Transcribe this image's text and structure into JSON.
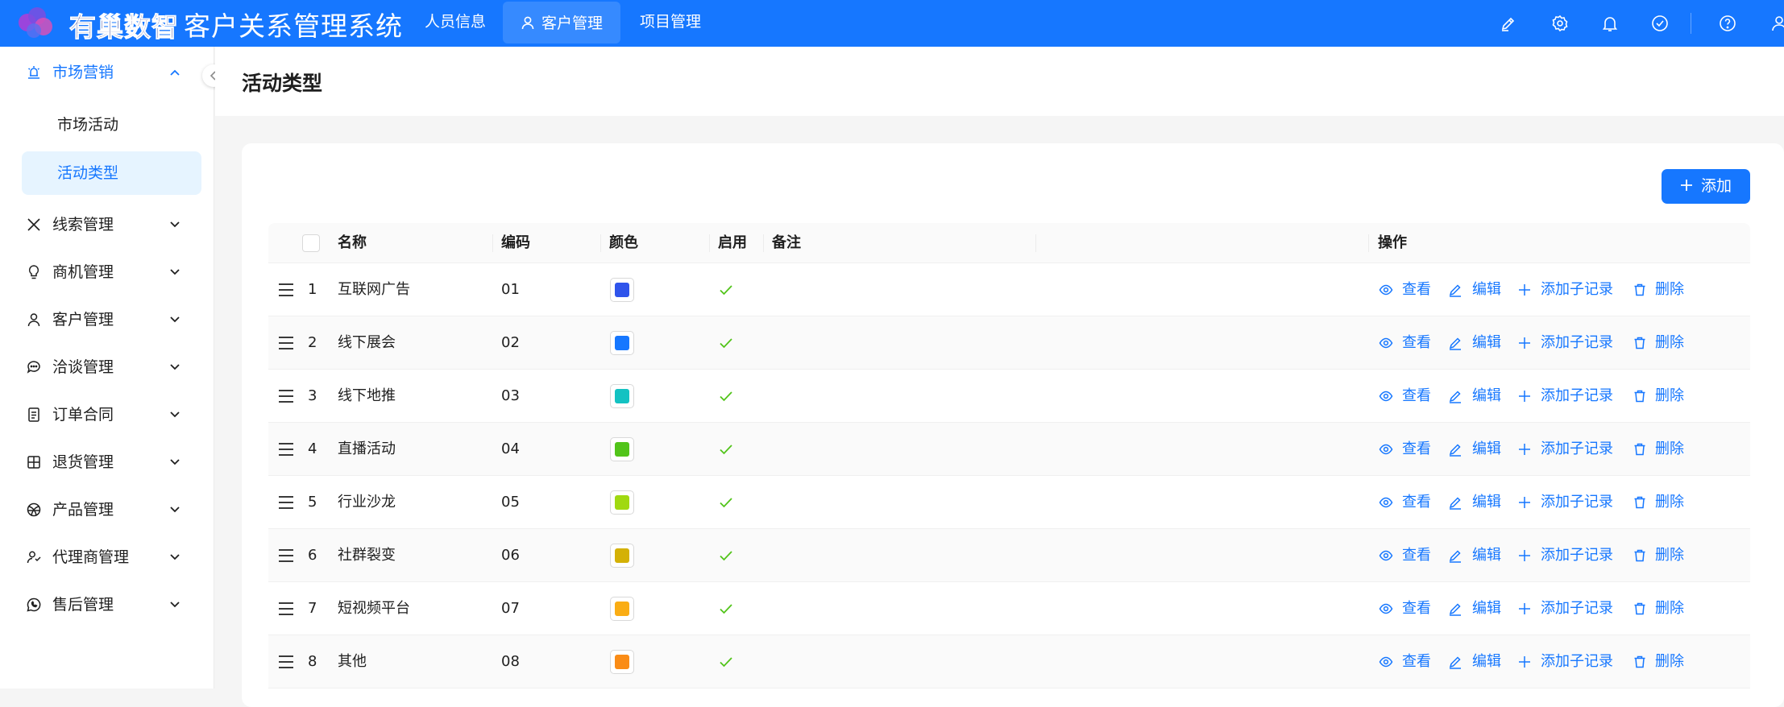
{
  "brand": {
    "logo_text": "有巢数智",
    "app_title": "客户关系管理系统",
    "primary_color": "#1677ff"
  },
  "top_nav": [
    {
      "label": "人员信息",
      "active": false
    },
    {
      "label": "客户管理",
      "active": true,
      "icon": "user-icon"
    },
    {
      "label": "项目管理",
      "active": false
    }
  ],
  "top_icons": [
    "brush-icon",
    "gear-icon",
    "bell-icon",
    "check-circle-icon",
    "help-icon",
    "user-icon"
  ],
  "sidebar": {
    "groups": [
      {
        "label": "市场营销",
        "icon": "lightbulb-alert-icon",
        "expanded": true,
        "children": [
          {
            "label": "市场活动",
            "active": false
          },
          {
            "label": "活动类型",
            "active": true
          }
        ]
      },
      {
        "label": "线索管理",
        "icon": "x-icon"
      },
      {
        "label": "商机管理",
        "icon": "bulb-icon"
      },
      {
        "label": "客户管理",
        "icon": "user-icon"
      },
      {
        "label": "洽谈管理",
        "icon": "chat-icon"
      },
      {
        "label": "订单合同",
        "icon": "document-icon"
      },
      {
        "label": "退货管理",
        "icon": "return-icon"
      },
      {
        "label": "产品管理",
        "icon": "product-icon"
      },
      {
        "label": "代理商管理",
        "icon": "agent-icon"
      },
      {
        "label": "售后管理",
        "icon": "whatsapp-icon"
      }
    ]
  },
  "page": {
    "title": "活动类型",
    "add_label": "添加"
  },
  "table": {
    "columns": {
      "name": "名称",
      "code": "编码",
      "color": "颜色",
      "enabled": "启用",
      "remark": "备注",
      "actions": "操作"
    },
    "actions": {
      "view": "查看",
      "edit": "编辑",
      "add_child": "添加子记录",
      "delete": "删除"
    },
    "rows": [
      {
        "index": "1",
        "name": "互联网广告",
        "code": "01",
        "color": "#2f54eb",
        "enabled": true
      },
      {
        "index": "2",
        "name": "线下展会",
        "code": "02",
        "color": "#1677ff",
        "enabled": true
      },
      {
        "index": "3",
        "name": "线下地推",
        "code": "03",
        "color": "#13c2c2",
        "enabled": true
      },
      {
        "index": "4",
        "name": "直播活动",
        "code": "04",
        "color": "#52c41a",
        "enabled": true
      },
      {
        "index": "5",
        "name": "行业沙龙",
        "code": "05",
        "color": "#a0d911",
        "enabled": true
      },
      {
        "index": "6",
        "name": "社群裂变",
        "code": "06",
        "color": "#d4b106",
        "enabled": true
      },
      {
        "index": "7",
        "name": "短视频平台",
        "code": "07",
        "color": "#faad14",
        "enabled": true
      },
      {
        "index": "8",
        "name": "其他",
        "code": "08",
        "color": "#fa8c16",
        "enabled": true
      }
    ]
  }
}
